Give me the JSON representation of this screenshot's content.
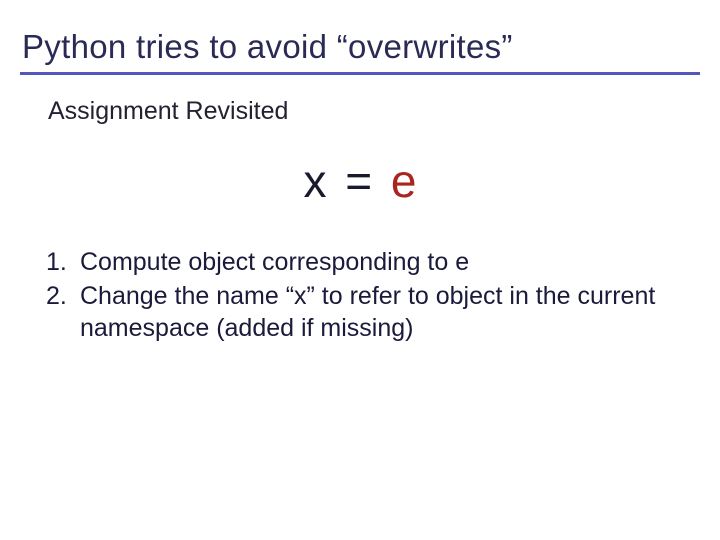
{
  "title": "Python tries to avoid “overwrites”",
  "subheading": "Assignment Revisited",
  "expression": {
    "lhs": "x",
    "op": "=",
    "rhs": "e"
  },
  "steps": [
    {
      "num": "1.",
      "text": "Compute object corresponding to e"
    },
    {
      "num": "2.",
      "text": "Change the name “x” to refer to object in the current namespace (added if missing)"
    }
  ]
}
